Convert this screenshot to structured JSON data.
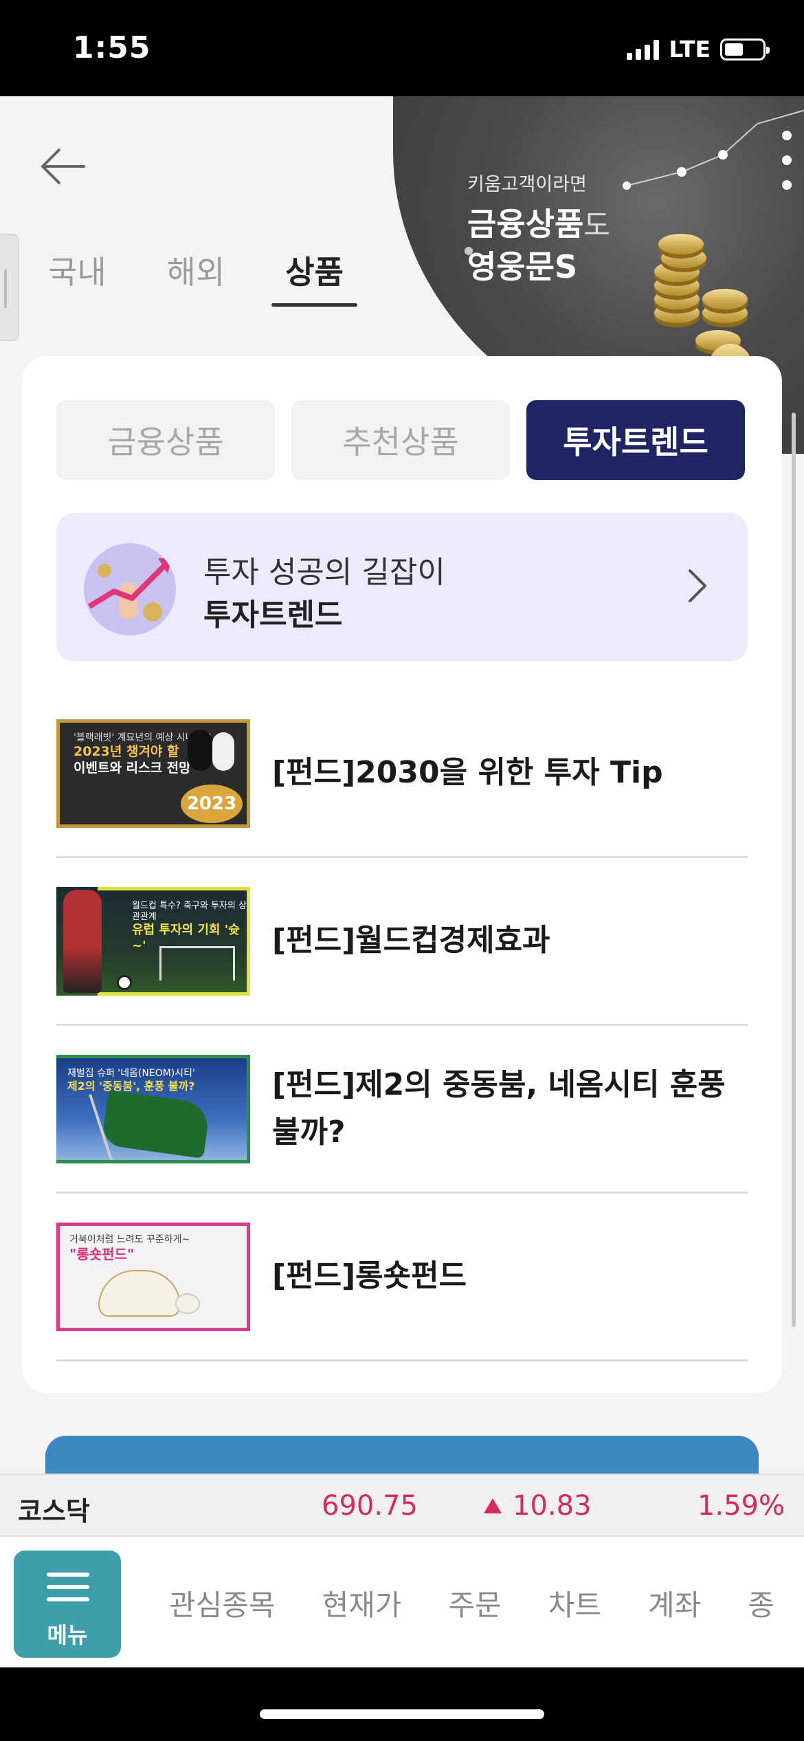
{
  "status": {
    "time": "1:55",
    "network": "LTE"
  },
  "banner": {
    "sub": "키움고객이라면",
    "title_bold": "금융상품",
    "title_suffix": "도",
    "title2": "영웅문S"
  },
  "top_tabs": [
    {
      "label": "국내",
      "active": false
    },
    {
      "label": "해외",
      "active": false
    },
    {
      "label": "상품",
      "active": true
    }
  ],
  "segments": [
    {
      "label": "금융상품",
      "active": false
    },
    {
      "label": "추천상품",
      "active": false
    },
    {
      "label": "투자트렌드",
      "active": true
    }
  ],
  "promo": {
    "line1": "투자 성공의 길잡이",
    "line2": "투자트렌드"
  },
  "articles": [
    {
      "title": "[펀드]2030을 위한 투자 Tip",
      "thumb_lines": [
        "'블랙래빗' 계묘년의 예상 시나리오",
        "2023년 챙겨야 할",
        "이벤트와 리스크 전망"
      ],
      "thumb_badge": "2023"
    },
    {
      "title": "[펀드]월드컵경제효과",
      "thumb_lines": [
        "월드컵 특수? 축구와 투자의 상관관계",
        "유럽 투자의 기회 '슛~'"
      ],
      "thumb_badge": ""
    },
    {
      "title": "[펀드]제2의 중동붐, 네옴시티 훈풍 불까?",
      "thumb_lines": [
        "재벌집 슈퍼 '네옴(NEOM)시티'",
        "제2의 '중동붐', 훈풍 불까?"
      ],
      "thumb_badge": ""
    },
    {
      "title": "[펀드]롱숏펀드",
      "thumb_lines": [
        "거북이처럼 느려도 꾸준하게~",
        "\"롱숏펀드\""
      ],
      "thumb_badge": ""
    }
  ],
  "ticker": {
    "name": "코스닥",
    "value": "690.75",
    "change": "10.83",
    "pct": "1.59%"
  },
  "bottom_nav": {
    "menu_label": "메뉴",
    "items": [
      "관심종목",
      "현재가",
      "주문",
      "차트",
      "계좌",
      "종"
    ]
  },
  "colors": {
    "accent_navy": "#1f2563",
    "up_red": "#d52b5b",
    "menu_teal": "#3e9ea9",
    "promo_bg": "#edeafd"
  }
}
